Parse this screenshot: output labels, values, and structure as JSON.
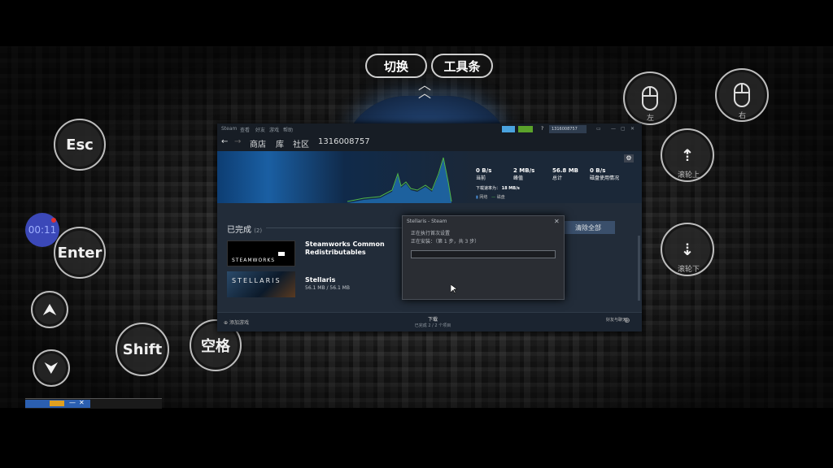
{
  "overlay": {
    "switch_label": "切换",
    "toolbar_label": "工具条",
    "esc_label": "Esc",
    "enter_label": "Enter",
    "shift_label": "Shift",
    "space_label": "空格",
    "timer": "00:11",
    "left_mouse_label": "左",
    "right_mouse_label": "右",
    "scroll_up_label": "滚轮上",
    "scroll_down_label": "滚轮下"
  },
  "steam": {
    "title": "Steam",
    "menu": [
      "查看",
      "好友",
      "游戏",
      "帮助"
    ],
    "nav": {
      "store": "商店",
      "library": "库",
      "community": "社区",
      "user": "1316008757"
    },
    "account": "1316008757",
    "stats": [
      {
        "value": "0 B/s",
        "label": "当前"
      },
      {
        "value": "2 MB/s",
        "label": "峰值"
      },
      {
        "value": "56.8 MB",
        "label": "总计"
      },
      {
        "value": "0 B/s",
        "label": "磁盘使用情况"
      }
    ],
    "download_speed_label": "下载速率为：",
    "download_speed_value": "18 MB/s",
    "legend_network": "网络",
    "legend_disk": "磁盘",
    "completed_label": "已完成",
    "completed_count": "(2)",
    "clear_all": "清除全部",
    "games": [
      {
        "thumb": "STEAMWORKS",
        "name": "Steamworks Common Redistributables",
        "size": ""
      },
      {
        "thumb": "STELLARIS",
        "name": "Stellaris",
        "size": "56.1 MB / 56.1 MB"
      }
    ],
    "footer_add_game": "添加游戏",
    "footer_downloads_title": "下载",
    "footer_downloads_status": "已完成 2 / 2 个项目",
    "footer_friends": "好友与聊天",
    "dialog": {
      "title": "Stellaris - Steam",
      "line1": "正在执行首次设置",
      "line2": "正在安装：（第 1 步，共 3 步）",
      "progress": 0
    }
  }
}
